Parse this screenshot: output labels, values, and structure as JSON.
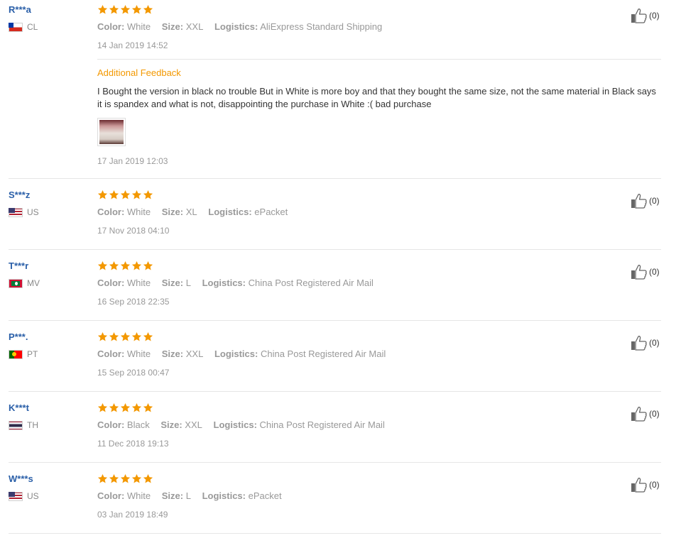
{
  "labels": {
    "color": "Color:",
    "size": "Size:",
    "logistics": "Logistics:",
    "additional_feedback": "Additional Feedback"
  },
  "colors": {
    "star": "#f39800",
    "user": "#2a5fa8",
    "accent": "#f39800"
  },
  "reviews": [
    {
      "user": "R***a",
      "country": "CL",
      "flag": "flag-cl-icon",
      "rating": 5,
      "color": "White",
      "size": "XXL",
      "logistics": "AliExpress Standard Shipping",
      "date": "14 Jan 2019 14:52",
      "likes": "(0)",
      "additional": {
        "text": "I Bought the version in black no trouble But in White is more boy and that they bought the same size, not the same material in Black says it is spandex and what is not, disappointing the purchase in White :( bad purchase",
        "date": "17 Jan 2019 12:03"
      }
    },
    {
      "user": "S***z",
      "country": "US",
      "flag": "flag-us-icon",
      "rating": 5,
      "color": "White",
      "size": "XL",
      "logistics": "ePacket",
      "date": "17 Nov 2018 04:10",
      "likes": "(0)"
    },
    {
      "user": "T***r",
      "country": "MV",
      "flag": "flag-mv-icon",
      "rating": 5,
      "color": "White",
      "size": "L",
      "logistics": "China Post Registered Air Mail",
      "date": "16 Sep 2018 22:35",
      "likes": "(0)"
    },
    {
      "user": "P***.",
      "country": "PT",
      "flag": "flag-pt-icon",
      "rating": 5,
      "color": "White",
      "size": "XXL",
      "logistics": "China Post Registered Air Mail",
      "date": "15 Sep 2018 00:47",
      "likes": "(0)"
    },
    {
      "user": "K***t",
      "country": "TH",
      "flag": "flag-th-icon",
      "rating": 5,
      "color": "Black",
      "size": "XXL",
      "logistics": "China Post Registered Air Mail",
      "date": "11 Dec 2018 19:13",
      "likes": "(0)"
    },
    {
      "user": "W***s",
      "country": "US",
      "flag": "flag-us-icon",
      "rating": 5,
      "color": "White",
      "size": "L",
      "logistics": "ePacket",
      "date": "03 Jan 2019 18:49",
      "likes": "(0)"
    }
  ]
}
